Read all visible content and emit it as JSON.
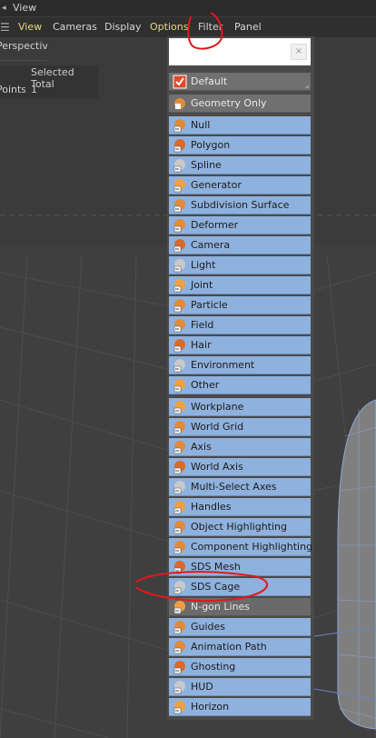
{
  "titlebar": {
    "label": "View"
  },
  "menubar": {
    "items": [
      "View",
      "Cameras",
      "Display",
      "Options",
      "Filter",
      "Panel"
    ]
  },
  "hud": {
    "perspective": "Perspective",
    "header": "Selected Total",
    "row_label": "Points",
    "row_value": "1"
  },
  "filter_menu": {
    "presets": [
      "Default",
      "Geometry Only"
    ],
    "objects": [
      "Null",
      "Polygon",
      "Spline",
      "Generator",
      "Subdivision Surface",
      "Deformer",
      "Camera",
      "Light",
      "Joint",
      "Particle",
      "Field",
      "Hair",
      "Environment",
      "Other"
    ],
    "display": [
      "Workplane",
      "World Grid",
      "Axis",
      "World Axis",
      "Multi-Select Axes",
      "Handles",
      "Object Highlighting",
      "Component Highlighting",
      "SDS Mesh",
      "SDS Cage",
      "N-gon Lines",
      "Guides",
      "Animation Path",
      "Ghosting",
      "HUD",
      "Horizon"
    ]
  },
  "colors": {
    "item_enabled": "#8fb1dd",
    "item_disabled": "#707070",
    "annotation": "#e0191b",
    "highlight_menu": "#e9d97a"
  }
}
